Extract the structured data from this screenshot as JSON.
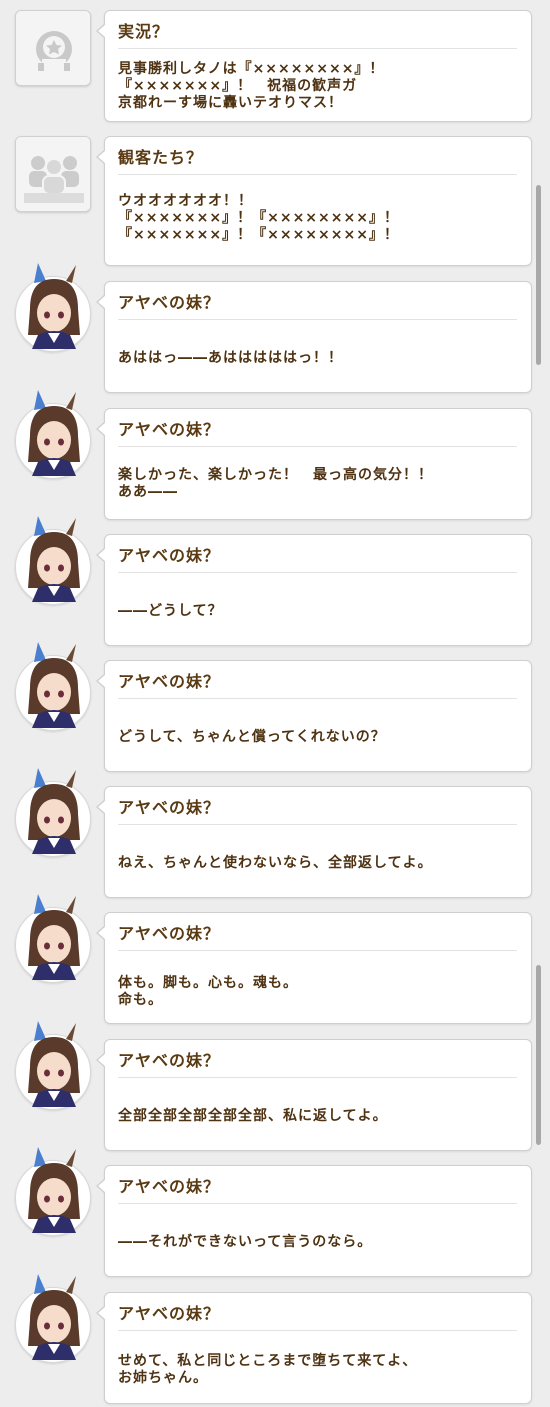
{
  "entries": [
    {
      "speaker": "実況？",
      "avatar": "generic-face-icon",
      "message": "見事勝利しタノは『××××××××』！\n『×××××××』！　祝福の歓声ガ\n京都れーす場に轟いテオりマス！"
    },
    {
      "speaker": "観客たち？",
      "avatar": "crowd-icon",
      "message": "ウオオオオオオ！！\n『×××××××』！『××××××××』！\n『×××××××』！『××××××××』！"
    },
    {
      "speaker": "アヤベの妹？",
      "avatar": "character-avatar",
      "message": "あははっ――あはははははっ！！"
    },
    {
      "speaker": "アヤベの妹？",
      "avatar": "character-avatar",
      "message": "楽しかった、楽しかった！　最っ高の気分！！\nああ――"
    },
    {
      "speaker": "アヤベの妹？",
      "avatar": "character-avatar",
      "message": "――どうして？"
    },
    {
      "speaker": "アヤベの妹？",
      "avatar": "character-avatar",
      "message": "どうして、ちゃんと償ってくれないの？"
    },
    {
      "speaker": "アヤベの妹？",
      "avatar": "character-avatar",
      "message": "ねえ、ちゃんと使わないなら、全部返してよ。"
    },
    {
      "speaker": "アヤベの妹？",
      "avatar": "character-avatar",
      "message": "体も。脚も。心も。魂も。\n命も。"
    },
    {
      "speaker": "アヤベの妹？",
      "avatar": "character-avatar",
      "message": "全部全部全部全部全部、私に返してよ。"
    },
    {
      "speaker": "アヤベの妹？",
      "avatar": "character-avatar",
      "message": "――それができないって言うのなら。"
    },
    {
      "speaker": "アヤベの妹？",
      "avatar": "character-avatar",
      "message": "せめて、私と同じところまで堕ちて来てよ、\nお姉ちゃん。"
    }
  ],
  "colors": {
    "speaker": "#5a3a12",
    "text": "#4e3212",
    "background": "#ededed",
    "ear_ribbon": "#4a7fd0",
    "hair": "#5a3a2a"
  }
}
